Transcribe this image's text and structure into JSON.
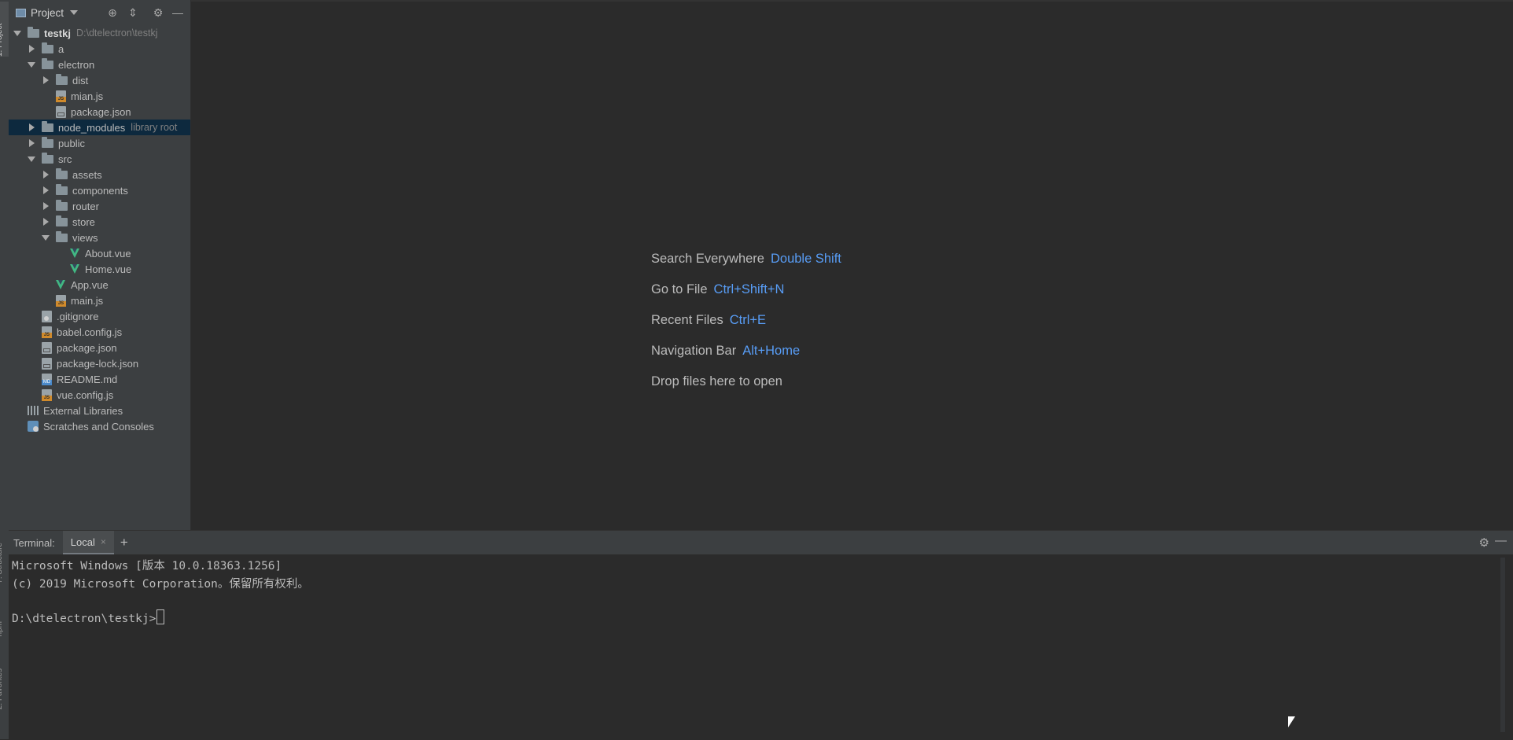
{
  "sidebar_strip": {
    "project": "1: Project",
    "structure": "7: Structure",
    "npm": "npm",
    "favorites": "2: Favorites"
  },
  "project_panel": {
    "title": "Project",
    "icons": [
      "locate-icon",
      "collapse-icon",
      "gear-icon",
      "minimize-icon"
    ],
    "tree": [
      {
        "name": "testkj",
        "hint": "D:\\dtelectron\\testkj",
        "type": "folder",
        "depth": 0,
        "expanded": true,
        "bold": true
      },
      {
        "name": "a",
        "type": "folder",
        "depth": 1,
        "expanded": false
      },
      {
        "name": "electron",
        "type": "folder",
        "depth": 1,
        "expanded": true
      },
      {
        "name": "dist",
        "type": "folder",
        "depth": 2,
        "expanded": false
      },
      {
        "name": "mian.js",
        "type": "js",
        "depth": 2
      },
      {
        "name": "package.json",
        "type": "json",
        "depth": 2
      },
      {
        "name": "node_modules",
        "hint": "library root",
        "type": "folder",
        "depth": 1,
        "expanded": false,
        "selected": true
      },
      {
        "name": "public",
        "type": "folder",
        "depth": 1,
        "expanded": false
      },
      {
        "name": "src",
        "type": "folder",
        "depth": 1,
        "expanded": true
      },
      {
        "name": "assets",
        "type": "folder",
        "depth": 2,
        "expanded": false
      },
      {
        "name": "components",
        "type": "folder",
        "depth": 2,
        "expanded": false
      },
      {
        "name": "router",
        "type": "folder",
        "depth": 2,
        "expanded": false
      },
      {
        "name": "store",
        "type": "folder",
        "depth": 2,
        "expanded": false
      },
      {
        "name": "views",
        "type": "folder",
        "depth": 2,
        "expanded": true
      },
      {
        "name": "About.vue",
        "type": "vue",
        "depth": 3
      },
      {
        "name": "Home.vue",
        "type": "vue",
        "depth": 3
      },
      {
        "name": "App.vue",
        "type": "vue",
        "depth": 2
      },
      {
        "name": "main.js",
        "type": "js",
        "depth": 2
      },
      {
        "name": ".gitignore",
        "type": "git",
        "depth": 1
      },
      {
        "name": "babel.config.js",
        "type": "js",
        "depth": 1
      },
      {
        "name": "package.json",
        "type": "json",
        "depth": 1
      },
      {
        "name": "package-lock.json",
        "type": "json",
        "depth": 1
      },
      {
        "name": "README.md",
        "type": "md",
        "depth": 1
      },
      {
        "name": "vue.config.js",
        "type": "js",
        "depth": 1
      },
      {
        "name": "External Libraries",
        "type": "lib",
        "depth": 0
      },
      {
        "name": "Scratches and Consoles",
        "type": "scratch",
        "depth": 0
      }
    ]
  },
  "welcome": [
    {
      "label": "Search Everywhere",
      "shortcut": "Double Shift"
    },
    {
      "label": "Go to File",
      "shortcut": "Ctrl+Shift+N"
    },
    {
      "label": "Recent Files",
      "shortcut": "Ctrl+E"
    },
    {
      "label": "Navigation Bar",
      "shortcut": "Alt+Home"
    },
    {
      "label": "Drop files here to open",
      "shortcut": ""
    }
  ],
  "terminal": {
    "label": "Terminal:",
    "tab": "Local",
    "close": "×",
    "add": "+",
    "lines": [
      "Microsoft Windows [版本 10.0.18363.1256]",
      "(c) 2019 Microsoft Corporation。保留所有权利。",
      "",
      "D:\\dtelectron\\testkj>"
    ]
  },
  "colors": {
    "background": "#2b2b2b",
    "panel": "#3c3f41",
    "selection": "#0d293e",
    "shortcut": "#589df6"
  }
}
